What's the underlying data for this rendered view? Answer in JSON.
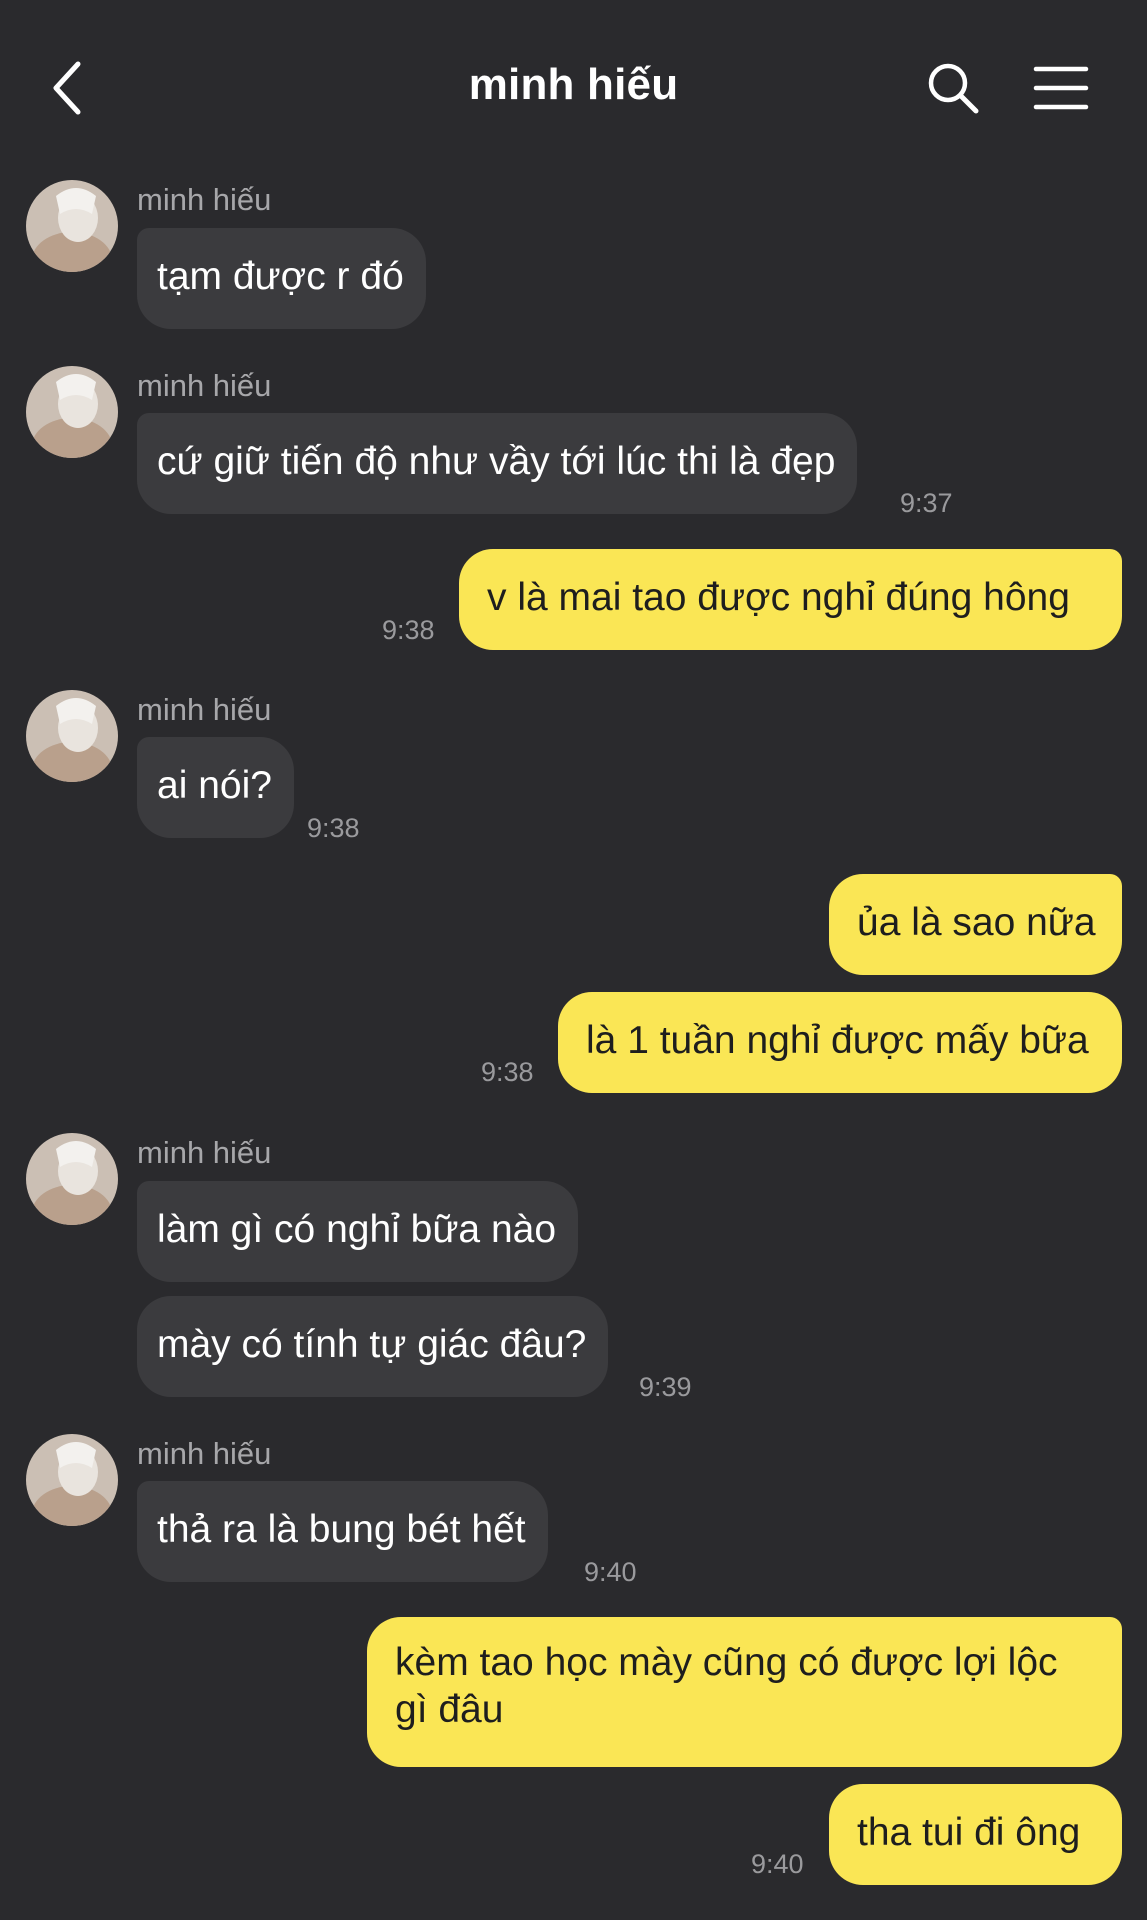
{
  "header": {
    "title": "minh hiếu",
    "back_icon": "chevron-left-icon",
    "search_icon": "search-icon",
    "menu_icon": "hamburger-menu-icon"
  },
  "colors": {
    "background": "#2a2a2d",
    "incoming_bubble": "#3b3b3e",
    "outgoing_bubble": "#fae655",
    "timestamp": "#9a9a9d"
  },
  "messages": [
    {
      "sender": "minh hiếu",
      "text": "tạm được r đó"
    },
    {
      "sender": "minh hiếu",
      "text": "cứ giữ tiến độ như vầy tới lúc thi là đẹp",
      "time": "9:37"
    },
    {
      "text": "v là mai tao được nghỉ đúng hông",
      "time": "9:38"
    },
    {
      "sender": "minh hiếu",
      "text": "ai nói?",
      "time": "9:38"
    },
    {
      "text": "ủa là sao nữa"
    },
    {
      "text": "là 1 tuần nghỉ được mấy bữa",
      "time": "9:38"
    },
    {
      "sender": "minh hiếu",
      "text": "làm gì có nghỉ bữa nào"
    },
    {
      "text": "mày có tính tự giác đâu?",
      "time": "9:39"
    },
    {
      "sender": "minh hiếu",
      "text": "thả ra là bung bét hết",
      "time": "9:40"
    },
    {
      "text": "kèm tao học mày cũng có được lợi lộc gì đâu"
    },
    {
      "text": "tha tui đi ông",
      "time": "9:40"
    }
  ]
}
